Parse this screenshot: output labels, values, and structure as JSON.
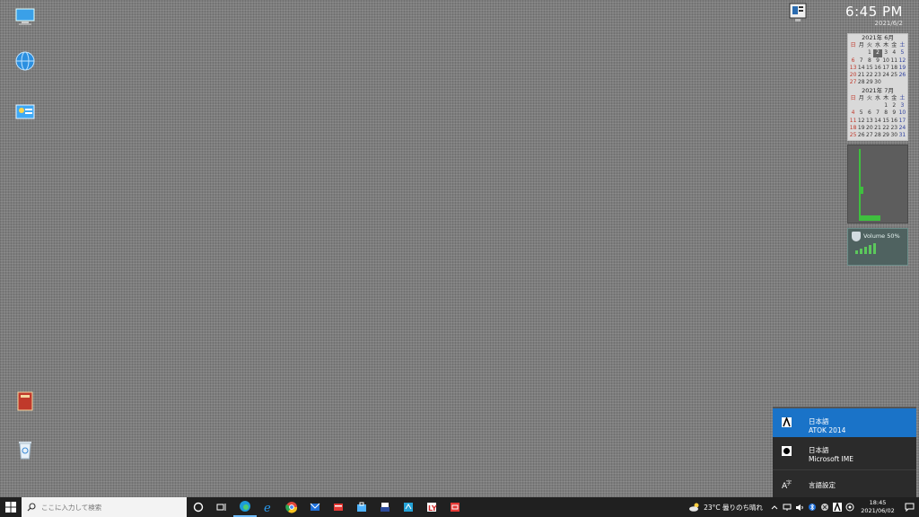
{
  "clock": {
    "time": "6:45 PM",
    "date": "2021/6/2"
  },
  "calendar": {
    "months": [
      {
        "title": "2021年 6月",
        "weekdays": [
          "日",
          "月",
          "火",
          "水",
          "木",
          "金",
          "土"
        ],
        "days": [
          "",
          "",
          "1",
          "2",
          "3",
          "4",
          "5",
          "6",
          "7",
          "8",
          "9",
          "10",
          "11",
          "12",
          "13",
          "14",
          "15",
          "16",
          "17",
          "18",
          "19",
          "20",
          "21",
          "22",
          "23",
          "24",
          "25",
          "26",
          "27",
          "28",
          "29",
          "30",
          "",
          "",
          ""
        ],
        "today": "2"
      },
      {
        "title": "2021年 7月",
        "weekdays": [
          "日",
          "月",
          "火",
          "水",
          "木",
          "金",
          "土"
        ],
        "days": [
          "",
          "",
          "",
          "",
          "1",
          "2",
          "3",
          "4",
          "5",
          "6",
          "7",
          "8",
          "9",
          "10",
          "11",
          "12",
          "13",
          "14",
          "15",
          "16",
          "17",
          "18",
          "19",
          "20",
          "21",
          "22",
          "23",
          "24",
          "25",
          "26",
          "27",
          "28",
          "29",
          "30",
          "31"
        ]
      }
    ]
  },
  "volume_widget": {
    "label": "Volume 50%",
    "level": 0.5
  },
  "language_flyout": {
    "items": [
      {
        "line1": "日本語",
        "line2": "ATOK 2014",
        "icon": "atok-icon",
        "selected": true
      },
      {
        "line1": "日本語",
        "line2": "Microsoft IME",
        "icon": "ime-icon",
        "selected": false
      }
    ],
    "settings_label": "言語設定"
  },
  "taskbar": {
    "search_placeholder": "ここに入力して検索",
    "apps": [
      "cortana-icon",
      "task-view-icon",
      "edge-icon",
      "ie-icon",
      "chrome-icon",
      "mail-icon",
      "app-red-icon",
      "store-icon",
      "app-printer-icon",
      "app-blue-icon",
      "app-ly-icon",
      "app-red2-icon"
    ],
    "weather": "23°C 曇りのち晴れ",
    "time": "18:45",
    "date": "2021/06/02"
  },
  "colors": {
    "accent": "#1a73c8",
    "taskbar": "#202020",
    "flyout": "#2b2b2b"
  }
}
